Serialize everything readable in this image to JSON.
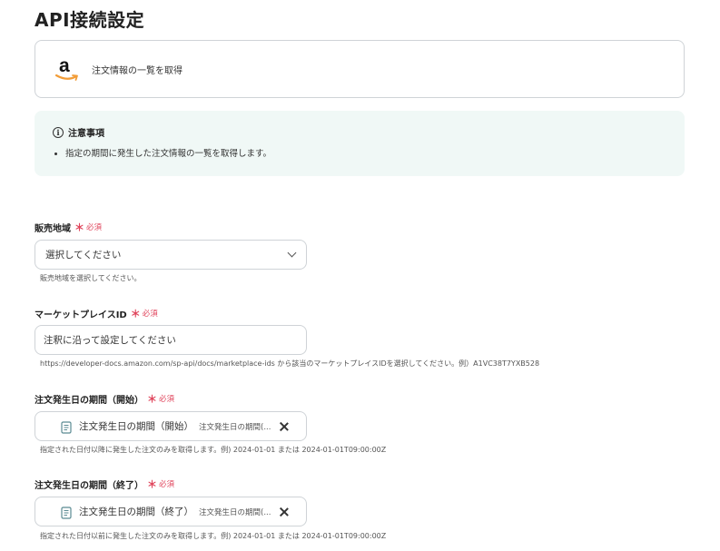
{
  "page": {
    "title": "API接続設定"
  },
  "action": {
    "icon": "amazon-logo-icon",
    "letter": "a",
    "name": "注文情報の一覧を取得"
  },
  "notice": {
    "icon": "info-icon",
    "title": "注意事項",
    "items": [
      "指定の期間に発生した注文情報の一覧を取得します。"
    ]
  },
  "required": {
    "mark": "＊",
    "text": "必須"
  },
  "fields": {
    "region": {
      "label": "販売地域",
      "value": "選択してください",
      "help": "販売地域を選択してください。"
    },
    "marketplace": {
      "label": "マーケットプレイスID",
      "placeholder": "注釈に沿って設定してください",
      "help": "https://developer-docs.amazon.com/sp-api/docs/marketplace-ids から該当のマーケットプレイスIDを選択してください。例）A1VC38T7YXB528"
    },
    "start_date": {
      "label": "注文発生日の期間（開始）",
      "token_label": "注文発生日の期間（開始）",
      "token_value": "注文発生日の期間(...",
      "help": "指定された日付以降に発生した注文のみを取得します。例) 2024-01-01 または 2024-01-01T09:00:00Z"
    },
    "end_date": {
      "label": "注文発生日の期間（終了）",
      "token_label": "注文発生日の期間（終了）",
      "token_value": "注文発生日の期間(...",
      "help": "指定された日付以前に発生した注文のみを取得します。例) 2024-01-01 または 2024-01-01T09:00:00Z"
    }
  },
  "colors": {
    "required": "#e0455c",
    "notice_bg": "#f0f8f6",
    "amazon_orange": "#f29d38"
  }
}
